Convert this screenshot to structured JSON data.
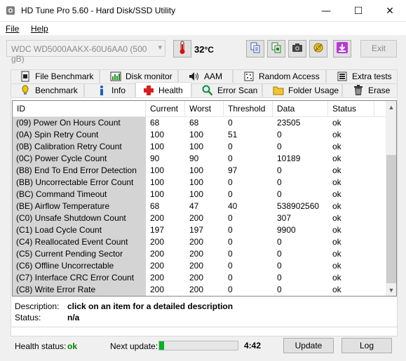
{
  "window": {
    "title": "HD Tune Pro 5.60 - Hard Disk/SSD Utility",
    "minimize": "—",
    "maximize": "☐",
    "close": "✕"
  },
  "menu": [
    {
      "label": "File",
      "accel": "F"
    },
    {
      "label": "Help",
      "accel": "H"
    }
  ],
  "toolbar": {
    "drive": "WDC WD5000AAKX-60U6AA0 (500 gB)",
    "temperature": "32",
    "temperature_unit": "°C",
    "exit_label": "Exit",
    "icons": [
      "copy-icon",
      "copy-screenshot-icon",
      "camera-icon",
      "options-icon",
      "save-download-icon"
    ]
  },
  "tabs_top": [
    {
      "label": "File Benchmark",
      "icon": "file-benchmark-icon"
    },
    {
      "label": "Disk monitor",
      "icon": "disk-monitor-icon"
    },
    {
      "label": "AAM",
      "icon": "speaker-icon"
    },
    {
      "label": "Random Access",
      "icon": "random-access-icon"
    },
    {
      "label": "Extra tests",
      "icon": "extra-tests-icon"
    }
  ],
  "tabs_bottom": [
    {
      "label": "Benchmark",
      "icon": "benchmark-icon"
    },
    {
      "label": "Info",
      "icon": "info-icon"
    },
    {
      "label": "Health",
      "icon": "health-cross-icon",
      "active": true
    },
    {
      "label": "Error Scan",
      "icon": "magnifier-icon"
    },
    {
      "label": "Folder Usage",
      "icon": "folder-icon"
    },
    {
      "label": "Erase",
      "icon": "trash-icon"
    }
  ],
  "table": {
    "columns": [
      "ID",
      "Current",
      "Worst",
      "Threshold",
      "Data",
      "Status"
    ],
    "rows": [
      [
        "(09) Power On Hours Count",
        "68",
        "68",
        "0",
        "23505",
        "ok"
      ],
      [
        "(0A) Spin Retry Count",
        "100",
        "100",
        "51",
        "0",
        "ok"
      ],
      [
        "(0B) Calibration Retry Count",
        "100",
        "100",
        "0",
        "0",
        "ok"
      ],
      [
        "(0C) Power Cycle Count",
        "90",
        "90",
        "0",
        "10189",
        "ok"
      ],
      [
        "(B8) End To End Error Detection",
        "100",
        "100",
        "97",
        "0",
        "ok"
      ],
      [
        "(BB) Uncorrectable Error Count",
        "100",
        "100",
        "0",
        "0",
        "ok"
      ],
      [
        "(BC) Command Timeout",
        "100",
        "100",
        "0",
        "0",
        "ok"
      ],
      [
        "(BE) Airflow Temperature",
        "68",
        "47",
        "40",
        "538902560",
        "ok"
      ],
      [
        "(C0) Unsafe Shutdown Count",
        "200",
        "200",
        "0",
        "307",
        "ok"
      ],
      [
        "(C1) Load Cycle Count",
        "197",
        "197",
        "0",
        "9900",
        "ok"
      ],
      [
        "(C4) Reallocated Event Count",
        "200",
        "200",
        "0",
        "0",
        "ok"
      ],
      [
        "(C5) Current Pending Sector",
        "200",
        "200",
        "0",
        "0",
        "ok"
      ],
      [
        "(C6) Offline Uncorrectable",
        "200",
        "200",
        "0",
        "0",
        "ok"
      ],
      [
        "(C7) Interface CRC Error Count",
        "200",
        "200",
        "0",
        "0",
        "ok"
      ],
      [
        "(C8) Write Error Rate",
        "200",
        "200",
        "0",
        "0",
        "ok"
      ]
    ]
  },
  "description": {
    "desc_label": "Description:",
    "desc_value": "click on an item for a detailed description",
    "status_label": "Status:",
    "status_value": "n/a"
  },
  "footer": {
    "health_label": "Health status:",
    "health_value": "ok",
    "next_update_label": "Next update:",
    "progress_fraction": 0.06,
    "time": "4:42",
    "update_button": "Update",
    "log_button": "Log"
  },
  "colors": {
    "health_ok": "#008000",
    "progress": "#06b025",
    "id_column_bg": "#d4d4d4"
  }
}
